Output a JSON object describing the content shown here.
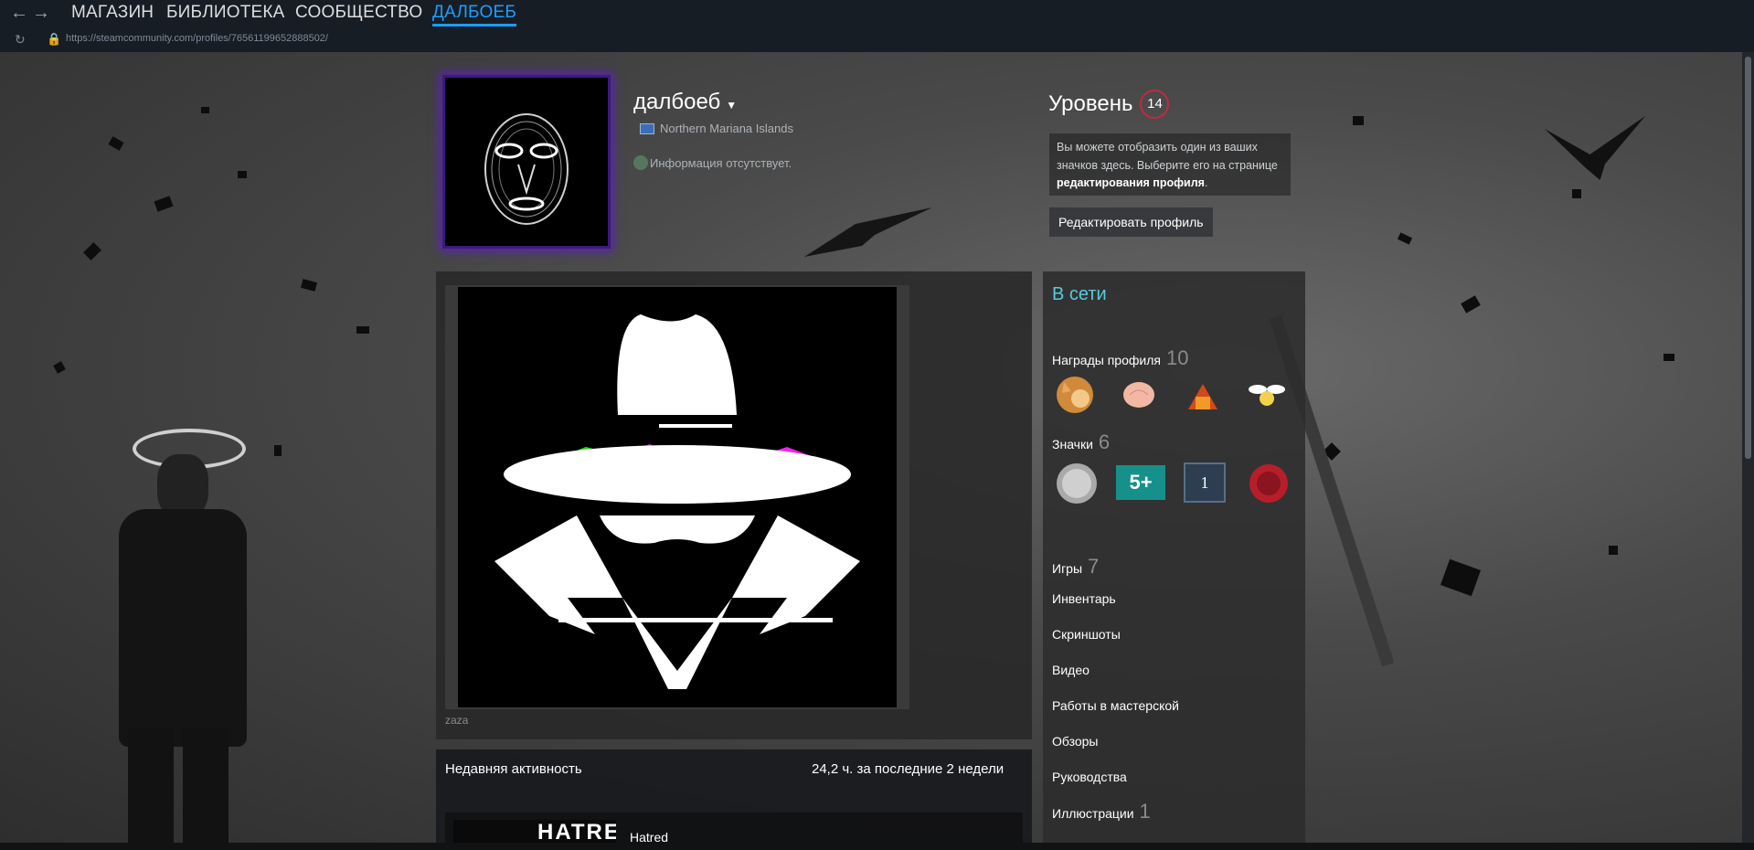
{
  "nav": {
    "back_icon": "arrow-left-icon",
    "forward_icon": "arrow-right-icon",
    "store": "МАГАЗИН",
    "library": "БИБЛИОТЕКА",
    "community": "СООБЩЕСТВО",
    "profile": "ДАЛБОЕБ",
    "url": "https://steamcommunity.com/profiles/76561199652888502/"
  },
  "profile": {
    "name": "далбоеб",
    "location": "Northern Mariana Islands",
    "no_info": "Информация отсутствует."
  },
  "level": {
    "label": "Уровень",
    "value": "14",
    "hint_text": "Вы можете отобразить один из ваших значков здесь. Выберите его на странице ",
    "hint_link": "редактирования профиля",
    "hint_end": ".",
    "edit_button": "Редактировать профиль"
  },
  "showcase": {
    "caption": "zaza"
  },
  "recent": {
    "title": "Недавняя активность",
    "hours": "24,2 ч. за последние 2 недели",
    "game_name": "Hatred",
    "game_thumb_text": "HATRED"
  },
  "sidebar": {
    "status": "В сети",
    "awards_label": "Награды профиля",
    "awards_count": "10",
    "badges_label": "Значки",
    "badges_count": "6",
    "badge_5plus": "5+",
    "badge_years": "1",
    "games_label": "Игры",
    "games_count": "7",
    "inventory": "Инвентарь",
    "screenshots": "Скриншоты",
    "videos": "Видео",
    "workshop": "Работы в мастерской",
    "reviews": "Обзоры",
    "guides": "Руководства",
    "artwork_label": "Иллюстрации",
    "artwork_count": "1"
  },
  "colors": {
    "accent": "#1a9fff",
    "online": "#57cbde",
    "level_ring": "#c02942"
  }
}
